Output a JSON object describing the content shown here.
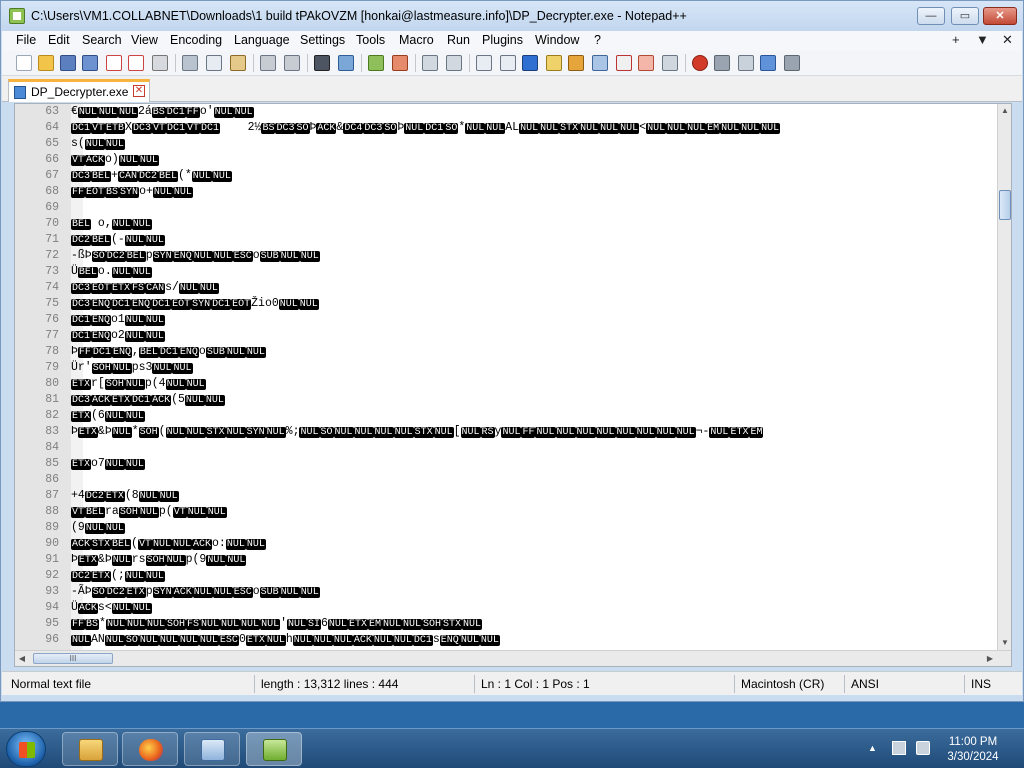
{
  "window": {
    "title": "C:\\Users\\VM1.COLLABNET\\Downloads\\1 build tPAkOVZM [honkai@lastmeasure.info]\\DP_Decrypter.exe - Notepad++",
    "minimize_label": "—",
    "maximize_label": "▭",
    "close_label": "✕"
  },
  "menu": {
    "items": [
      "File",
      "Edit",
      "Search",
      "View",
      "Encoding",
      "Language",
      "Settings",
      "Tools",
      "Macro",
      "Run",
      "Plugins",
      "Window",
      "?"
    ],
    "right_add": "+",
    "right_down": "▼",
    "right_close": "✕"
  },
  "toolbar": {
    "icons": [
      "new-file-icon",
      "open-file-icon",
      "save-icon",
      "save-all-icon",
      "close-icon",
      "close-all-icon",
      "print-icon",
      "cut-icon",
      "copy-icon",
      "paste-icon",
      "undo-icon",
      "redo-icon",
      "find-icon",
      "replace-icon",
      "zoom-in-icon",
      "zoom-out-icon",
      "sync-v-icon",
      "sync-h-icon",
      "wrap-icon",
      "show-all-chars-icon",
      "indent-guide-icon",
      "udl-icon",
      "doc-map-icon",
      "function-list-icon",
      "folder-workspace-icon",
      "monitor-icon",
      "record-macro-icon",
      "stop-macro-icon",
      "play-macro-icon",
      "run-macro-multiple-icon",
      "save-macro-icon"
    ]
  },
  "tab": {
    "label": "DP_Decrypter.exe",
    "close": "✕"
  },
  "editor": {
    "lines": [
      {
        "n": "63",
        "t": "€[NUL][NUL][NUL]2á[BS][DC1][FF]o'[NUL][NUL]"
      },
      {
        "n": "64",
        "t": "[DC1][VT][ETB]X[DC3][VT][DC1][VT][DC1]    2½[BS][DC3][SO]Þ[ACK]&[DC4][DC3][SO]Þ[NUL][DC1][SO]*[NUL][NUL]AL[NUL][NUL][STX][NUL][NUL][NUL]<[NUL][NUL][NUL][EM][NUL][NUL][NUL]"
      },
      {
        "n": "65",
        "t": "s([NUL][NUL]"
      },
      {
        "n": "66",
        "t": "[VT][ACK]o)[NUL][NUL]"
      },
      {
        "n": "67",
        "t": "[DC3][BEL]+[CAN][DC2][BEL](*[NUL][NUL]"
      },
      {
        "n": "68",
        "t": "[FF][EOT][BS][SYN]o+[NUL][NUL]"
      },
      {
        "n": "69",
        "t": ""
      },
      {
        "n": "70",
        "t": "[BEL] o,[NUL][NUL]"
      },
      {
        "n": "71",
        "t": "[DC2][BEL](-[NUL][NUL]"
      },
      {
        "n": "72",
        "t": "-ßÞ[SO][DC2][BEL]p[SYN][ENQ][NUL][NUL][ESC]o[SUB][NUL][NUL]"
      },
      {
        "n": "73",
        "t": "Ü[BEL]o.[NUL][NUL]"
      },
      {
        "n": "74",
        "t": "[DC3][EOT][ETX][FS][CAN]s/[NUL][NUL]"
      },
      {
        "n": "75",
        "t": "[DC3][ENQ][DC1][ENQ][DC1][EOT][SYN][DC1][EOT]Žio0[NUL][NUL]"
      },
      {
        "n": "76",
        "t": "[DC1][ENQ]o1[NUL][NUL]"
      },
      {
        "n": "77",
        "t": "[DC1][ENQ]o2[NUL][NUL]"
      },
      {
        "n": "78",
        "t": "Þ[FF][DC1][ENQ],[BEL][DC1][ENQ]o[SUB][NUL][NUL]"
      },
      {
        "n": "79",
        "t": "Ür'[SOH][NUL]ps3[NUL][NUL]"
      },
      {
        "n": "80",
        "t": "[ETX]r[[SOH][NUL]p(4[NUL][NUL]"
      },
      {
        "n": "81",
        "t": "[DC3][ACK][ETX][DC1][ACK](5[NUL][NUL]"
      },
      {
        "n": "82",
        "t": "[ETX](6[NUL][NUL]"
      },
      {
        "n": "83",
        "t": "Þ[ETX]&Þ[NUL]*[SOH]([NUL][NUL][STX][NUL][SYN][NUL]%;[NUL][SO][NUL][NUL][NUL][NUL][STX][NUL][[NUL][RS]y[NUL][FF][NUL][NUL][NUL][NUL][NUL][NUL][NUL][NUL]¬-[NUL][ETX][EM]"
      },
      {
        "n": "84",
        "t": ""
      },
      {
        "n": "85",
        "t": "[ETX]o7[NUL][NUL]"
      },
      {
        "n": "86",
        "t": ""
      },
      {
        "n": "87",
        "t": "+4[DC2][ETX](8[NUL][NUL]"
      },
      {
        "n": "88",
        "t": "[VT][BEL]ra[SOH][NUL]p([VT][NUL][NUL]"
      },
      {
        "n": "89",
        "t": "(9[NUL][NUL]"
      },
      {
        "n": "90",
        "t": "[ACK][STX][BEL]([VT][NUL][NUL][ACK]o:[NUL][NUL]"
      },
      {
        "n": "91",
        "t": "Þ[ETX]&Þ[NUL]rs[SOH][NUL]p(9[NUL][NUL]"
      },
      {
        "n": "92",
        "t": "[DC2][ETX](;[NUL][NUL]"
      },
      {
        "n": "93",
        "t": "-ÃÞ[SO][DC2][ETX]p[SYN][ACK][NUL][NUL][ESC]o[SUB][NUL][NUL]"
      },
      {
        "n": "94",
        "t": "Ü[ACK]s<[NUL][NUL]"
      },
      {
        "n": "95",
        "t": "[FF][BS]*[NUL][NUL][NUL][SOH][FS][NUL][NUL][NUL][NUL]'[NUL][SI]6[NUL][ETX][EM][NUL][NUL][SOH][STX][NUL]"
      },
      {
        "n": "96",
        "t": "[NUL]AN[NUL][SO][NUL][NUL][NUL][NUL][ESC]0[ETX][NUL]h[NUL][NUL][NUL][ACK][NUL][NUL][DC1]s[ENQ][NUL][NUL]"
      }
    ],
    "hscroll_grip": "III"
  },
  "status": {
    "type": "Normal text file",
    "length": "length : 13,312    lines : 444",
    "position": "Ln : 1    Col : 1    Pos : 1",
    "eol": "Macintosh (CR)",
    "encoding": "ANSI",
    "mode": "INS"
  },
  "taskbar": {
    "time": "11:00 PM",
    "date": "3/30/2024"
  },
  "colors": {
    "accent_tab": "#f7b33d",
    "control_char_bg": "#000000"
  }
}
